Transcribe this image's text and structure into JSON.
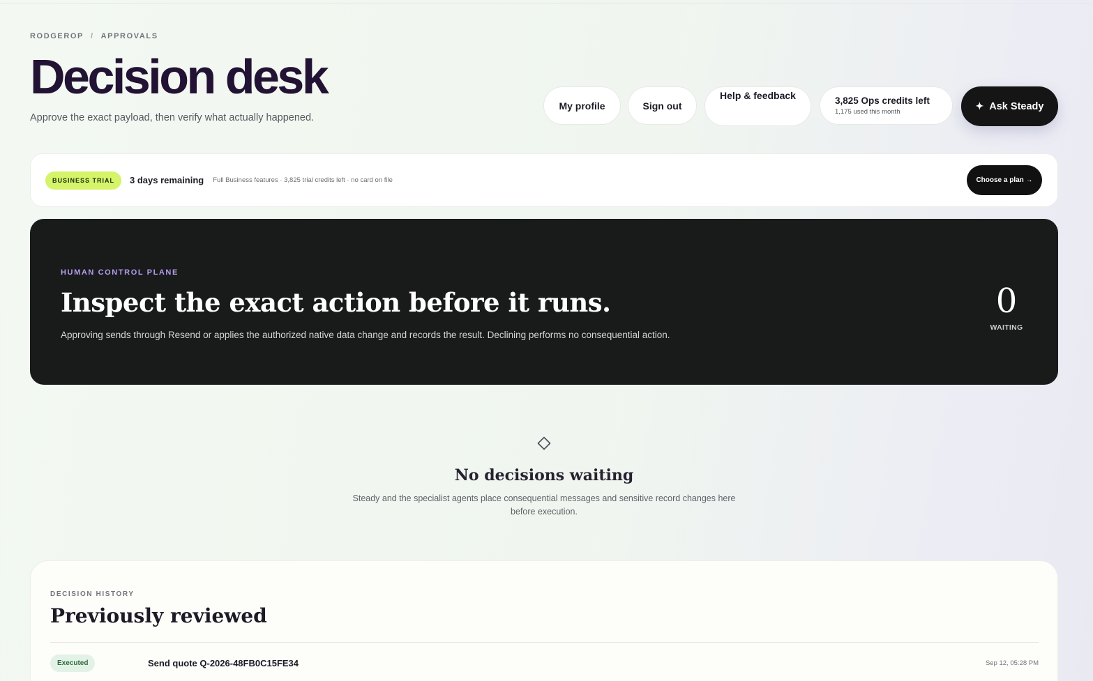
{
  "breadcrumb": {
    "org": "RODGEROP",
    "separator": "/",
    "section": "APPROVALS"
  },
  "header": {
    "title": "Decision desk",
    "subtitle": "Approve the exact payload, then verify what actually happened."
  },
  "nav": {
    "my_profile": "My profile",
    "sign_out": "Sign out",
    "help": "Help & feedback",
    "credits_left": "3,825 Ops credits left",
    "credits_used": "1,175 used this month",
    "ask_label": "Ask Steady",
    "ask_icon": "sparkle-icon"
  },
  "trial": {
    "badge": "BUSINESS TRIAL",
    "days": "3 days remaining",
    "meta": "Full Business features · 3,825 trial credits left · no card on file",
    "cta": "Choose a plan →",
    "badge_color": "#d5f46a"
  },
  "hero": {
    "kicker": "HUMAN CONTROL PLANE",
    "title": "Inspect the exact action before it runs.",
    "description": "Approving sends through Resend or applies the authorized native data change and records the result. Declining performs no consequential action.",
    "waiting_count": "0",
    "waiting_label": "WAITING",
    "kicker_color": "#b79cf0"
  },
  "empty_state": {
    "icon": "diamond-icon",
    "title": "No decisions waiting",
    "description": "Steady and the specialist agents place consequential messages and sensitive record changes here before execution."
  },
  "history": {
    "kicker": "DECISION HISTORY",
    "title": "Previously reviewed",
    "rows": [
      {
        "status": "Executed",
        "title": "Send quote Q-2026-48FB0C15FE34",
        "time": "Sep 12, 05:28 PM"
      }
    ]
  }
}
